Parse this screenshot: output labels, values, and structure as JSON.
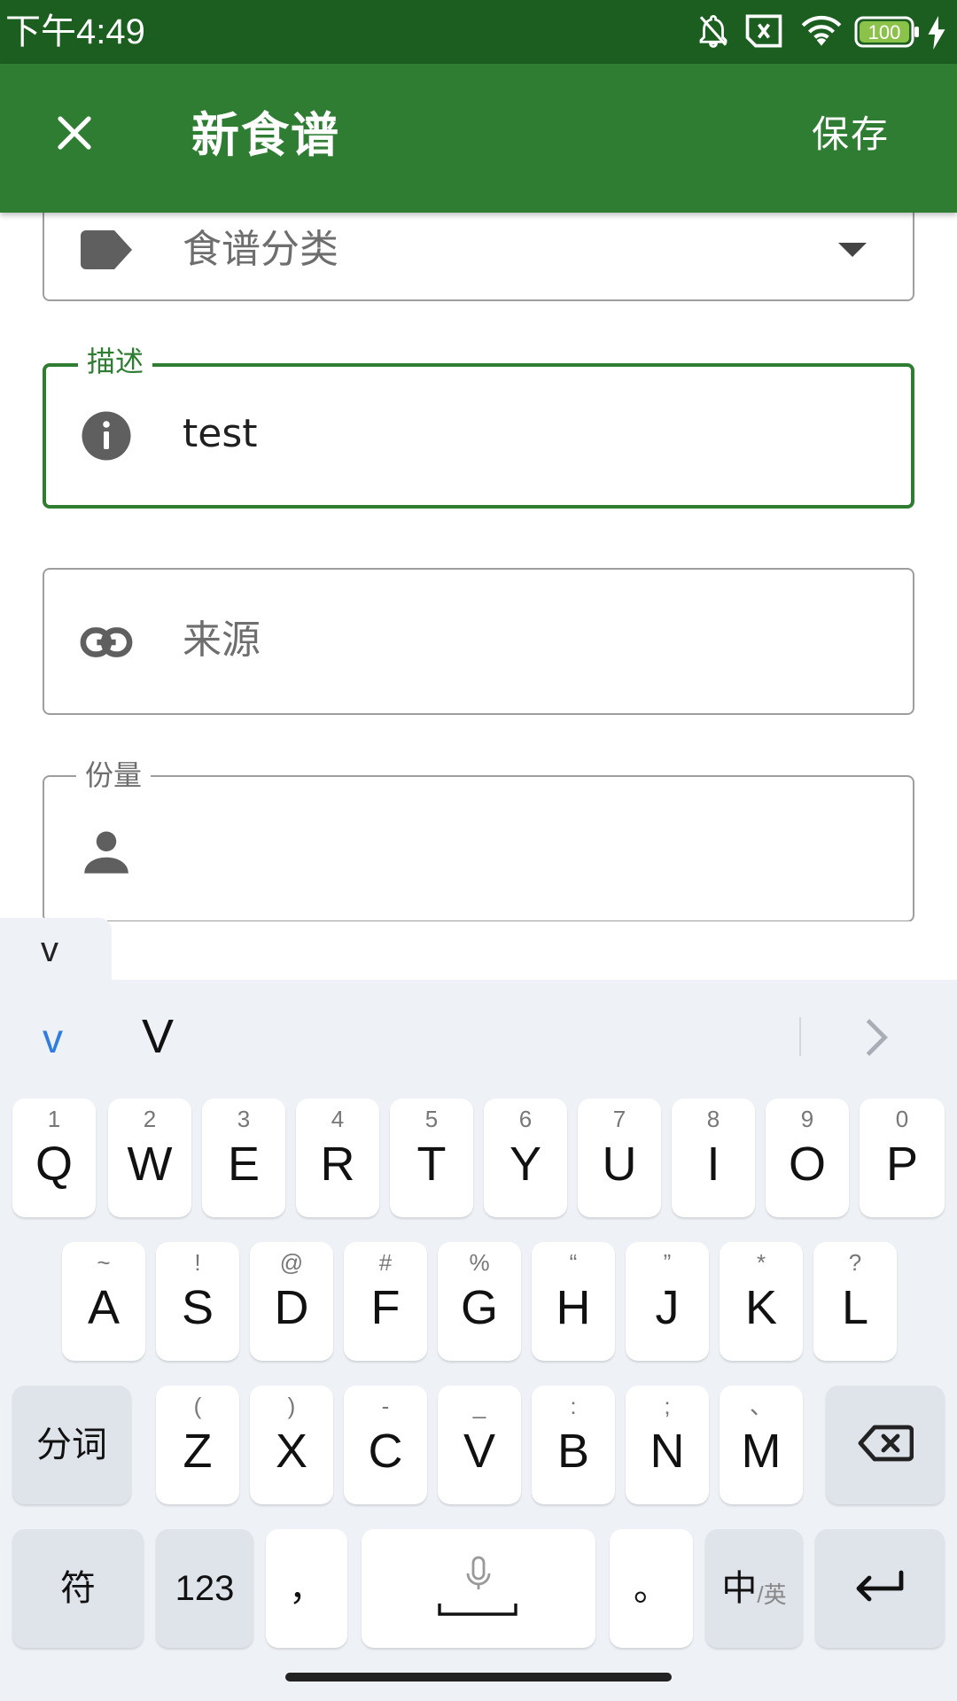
{
  "status_bar": {
    "time": "下午4:49",
    "battery": "100",
    "icons": [
      "mute-bell-icon",
      "sim-error-icon",
      "wifi-icon",
      "battery-icon",
      "charging-icon"
    ]
  },
  "app_bar": {
    "title": "新食谱",
    "save_label": "保存",
    "close_icon": "close-icon",
    "color": "#2e7d32",
    "status_color": "#1b5e20"
  },
  "form": {
    "category": {
      "placeholder": "食谱分类",
      "icon": "label-tag-icon"
    },
    "description": {
      "label": "描述",
      "value": "test",
      "icon": "info-icon",
      "focus_color": "#2e7d32"
    },
    "source": {
      "placeholder": "来源",
      "icon": "link-icon"
    },
    "servings": {
      "label": "份量",
      "value": "",
      "icon": "person-icon"
    }
  },
  "keyboard": {
    "composing": "v",
    "candidates": [
      "v",
      "V"
    ],
    "candidate_highlight_color": "#2f7de1",
    "row1": [
      {
        "main": "Q",
        "sub": "1"
      },
      {
        "main": "W",
        "sub": "2"
      },
      {
        "main": "E",
        "sub": "3"
      },
      {
        "main": "R",
        "sub": "4"
      },
      {
        "main": "T",
        "sub": "5"
      },
      {
        "main": "Y",
        "sub": "6"
      },
      {
        "main": "U",
        "sub": "7"
      },
      {
        "main": "I",
        "sub": "8"
      },
      {
        "main": "O",
        "sub": "9"
      },
      {
        "main": "P",
        "sub": "0"
      }
    ],
    "row2": [
      {
        "main": "A",
        "sub": "~"
      },
      {
        "main": "S",
        "sub": "!"
      },
      {
        "main": "D",
        "sub": "@"
      },
      {
        "main": "F",
        "sub": "#"
      },
      {
        "main": "G",
        "sub": "%"
      },
      {
        "main": "H",
        "sub": "“"
      },
      {
        "main": "J",
        "sub": "”"
      },
      {
        "main": "K",
        "sub": "*"
      },
      {
        "main": "L",
        "sub": "?"
      }
    ],
    "row3": [
      {
        "main": "Z",
        "sub": "("
      },
      {
        "main": "X",
        "sub": ")"
      },
      {
        "main": "C",
        "sub": "-"
      },
      {
        "main": "V",
        "sub": "_"
      },
      {
        "main": "B",
        "sub": ":"
      },
      {
        "main": "N",
        "sub": ";"
      },
      {
        "main": "M",
        "sub": "、"
      }
    ],
    "segment_label": "分词",
    "symbols_label": "符",
    "numbers_label": "123",
    "comma_label": "，",
    "period_label": "。",
    "lang_main": "中",
    "lang_sub": "/英"
  }
}
